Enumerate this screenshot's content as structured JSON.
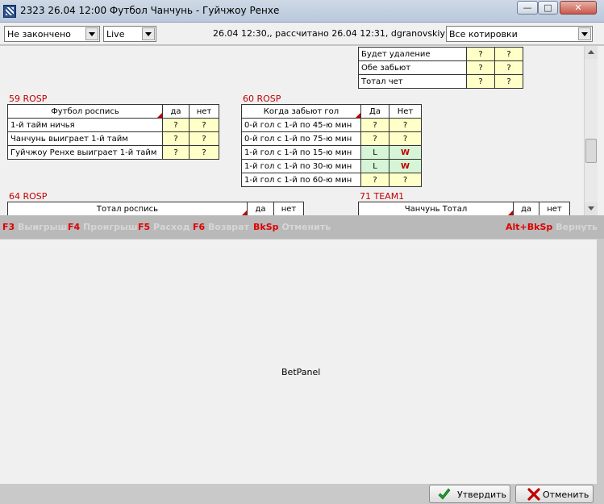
{
  "window": {
    "title": "2323 26.04 12:00 Футбол Чанчунь - Гуйчжоу Ренхе"
  },
  "toolbar": {
    "status_filter": "Не закончено",
    "mode": "Live",
    "info": "26.04 12:30,, рассчитано 26.04 12:31, dgranovskiy",
    "odds_filter": "Все котировки"
  },
  "markets": {
    "top_right": {
      "rows": [
        {
          "label": "Будет удаление",
          "yes": "?",
          "no": "?"
        },
        {
          "label": "Обе забьют",
          "yes": "?",
          "no": "?"
        },
        {
          "label": "Тотал чет",
          "yes": "?",
          "no": "?"
        }
      ]
    },
    "m59": {
      "title": "59 ROSP",
      "header": {
        "name": "Футбол роспись",
        "yes": "да",
        "no": "нет"
      },
      "rows": [
        {
          "label": "1-й тайм ничья",
          "yes": "?",
          "no": "?"
        },
        {
          "label": "Чанчунь выиграет 1-й тайм",
          "yes": "?",
          "no": "?"
        },
        {
          "label": "Гуйчжоу Ренхе выиграет 1-й тайм",
          "yes": "?",
          "no": "?"
        }
      ]
    },
    "m60": {
      "title": "60 ROSP",
      "header": {
        "name": "Когда забьют гол",
        "yes": "Да",
        "no": "Нет"
      },
      "rows": [
        {
          "label": "0-й гол с 1-й по 45-ю мин",
          "yes": "?",
          "no": "?"
        },
        {
          "label": "0-й гол с 1-й по 75-ю мин",
          "yes": "?",
          "no": "?"
        },
        {
          "label": "1-й гол с 1-й по 15-ю мин",
          "yes": "L",
          "no": "W"
        },
        {
          "label": "1-й гол с 1-й по 30-ю мин",
          "yes": "L",
          "no": "W"
        },
        {
          "label": "1-й гол с 1-й по 60-ю мин",
          "yes": "?",
          "no": "?"
        }
      ]
    },
    "m64": {
      "title": "64 ROSP",
      "header": {
        "name": "Тотал роспись",
        "yes": "да",
        "no": "нет"
      }
    },
    "m71": {
      "title": "71 TEAM1",
      "header": {
        "name": "Чанчунь Тотал",
        "yes": "да",
        "no": "нет"
      }
    }
  },
  "hotkeys": {
    "f3_key": "F3",
    "f3_action": "Выигрыш",
    "f4_key": "F4",
    "f4_action": "Проигрыш",
    "f5_key": "F5",
    "f5_action": "Расход",
    "f6_key": "F6",
    "f6_action": "Возврат",
    "bksp_key": "BkSp",
    "bksp_action": "Отменить",
    "altbksp_key": "Alt+BkSp",
    "altbksp_action": "Вернуть"
  },
  "bet_panel": {
    "label": "BetPanel"
  },
  "buttons": {
    "confirm": "Утвердить",
    "cancel": "Отменить"
  },
  "colors": {
    "accent_red": "#c00000",
    "cell_yellow": "#ffffc8",
    "cell_green": "#d6f5d6"
  }
}
